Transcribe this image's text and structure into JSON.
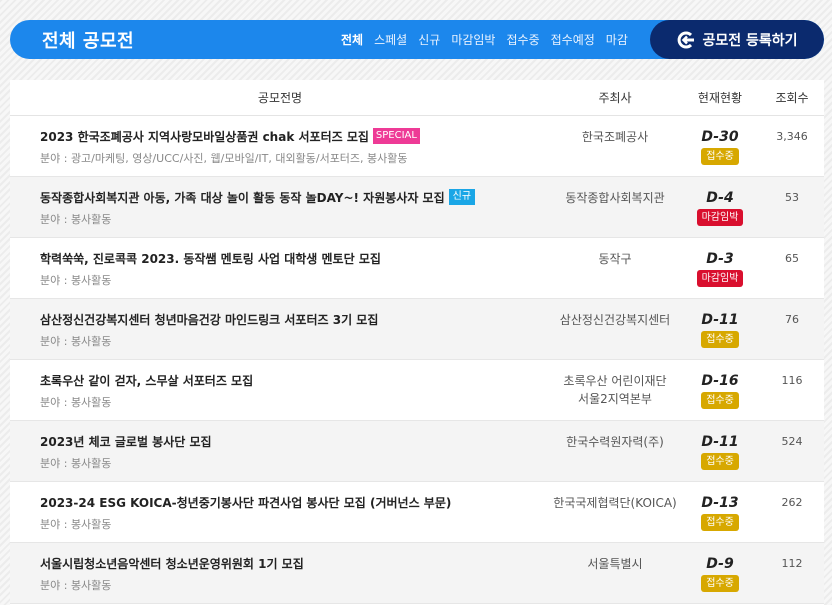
{
  "header": {
    "title": "전체 공모전",
    "nav": [
      "전체",
      "스페셜",
      "신규",
      "마감임박",
      "접수중",
      "접수예정",
      "마감"
    ],
    "register_label": "공모전 등록하기"
  },
  "table": {
    "headers": {
      "name": "공모전명",
      "org": "주최사",
      "status": "현재현황",
      "views": "조회수"
    },
    "rows": [
      {
        "title": "2023 한국조폐공사 지역사랑모바일상품권 chak 서포터즈 모집",
        "badge": "SPECIAL",
        "field": "분야 : 광고/마케팅, 영상/UCC/사진, 웹/모바일/IT, 대외활동/서포터즈, 봉사활동",
        "org": "한국조폐공사",
        "org2": "",
        "dday": "D-30",
        "state": "접수중",
        "views": "3,346"
      },
      {
        "title": "동작종합사회복지관 아동, 가족 대상 놀이 활동 동작 놀DAY~! 자원봉사자 모집",
        "badge": "신규",
        "field": "분야 : 봉사활동",
        "org": "동작종합사회복지관",
        "org2": "",
        "dday": "D-4",
        "state": "마감임박",
        "views": "53"
      },
      {
        "title": "학력쑥쑥, 진로콕콕 2023. 동작쌤 멘토링 사업 대학생 멘토단 모집",
        "badge": "",
        "field": "분야 : 봉사활동",
        "org": "동작구",
        "org2": "",
        "dday": "D-3",
        "state": "마감임박",
        "views": "65"
      },
      {
        "title": "삼산정신건강복지센터 청년마음건강 마인드링크 서포터즈 3기 모집",
        "badge": "",
        "field": "분야 : 봉사활동",
        "org": "삼산정신건강복지센터",
        "org2": "",
        "dday": "D-11",
        "state": "접수중",
        "views": "76"
      },
      {
        "title": "초록우산 같이 걷자, 스무살 서포터즈 모집",
        "badge": "",
        "field": "분야 : 봉사활동",
        "org": "초록우산 어린이재단",
        "org2": "서울2지역본부",
        "dday": "D-16",
        "state": "접수중",
        "views": "116"
      },
      {
        "title": "2023년 체코 글로벌 봉사단 모집",
        "badge": "",
        "field": "분야 : 봉사활동",
        "org": "한국수력원자력(주)",
        "org2": "",
        "dday": "D-11",
        "state": "접수중",
        "views": "524"
      },
      {
        "title": "2023-24 ESG KOICA-청년중기봉사단 파견사업 봉사단 모집 (거버넌스 부문)",
        "badge": "",
        "field": "분야 : 봉사활동",
        "org": "한국국제협력단(KOICA)",
        "org2": "",
        "dday": "D-13",
        "state": "접수중",
        "views": "262"
      },
      {
        "title": "서울시립청소년음악센터 청소년운영위원회 1기 모집",
        "badge": "",
        "field": "분야 : 봉사활동",
        "org": "서울특별시",
        "org2": "",
        "dday": "D-9",
        "state": "접수중",
        "views": "112"
      }
    ]
  },
  "colors": {
    "header_bg": "#1c87ec",
    "register_bg": "#0b2a6e",
    "open": "#d7a800",
    "closing": "#d90f2e",
    "special": "#ee3a96",
    "new": "#1aa6e6"
  },
  "icons": {
    "register": "g-arrow-icon"
  }
}
